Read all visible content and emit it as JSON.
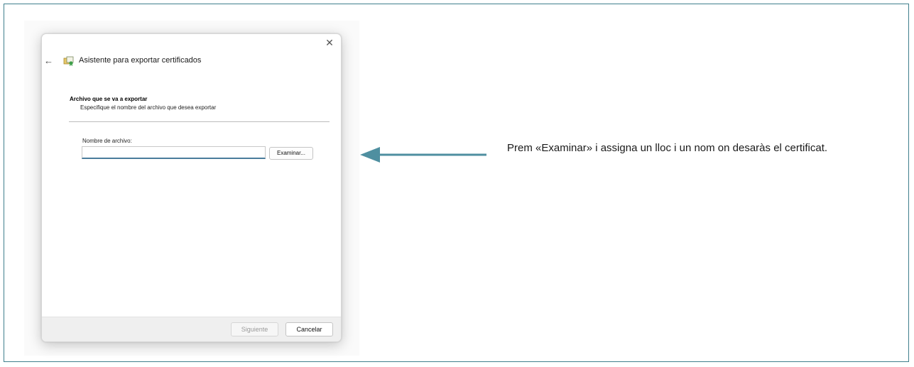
{
  "dialog": {
    "title": "Asistente para exportar certificados",
    "close_glyph": "✕",
    "back_glyph": "←",
    "section_heading": "Archivo que se va a exportar",
    "section_subtitle": "Especifique el nombre del archivo que desea exportar",
    "filename_label": "Nombre de archivo:",
    "filename_value": "",
    "browse_label": "Examinar...",
    "next_label": "Siguiente",
    "cancel_label": "Cancelar"
  },
  "annotation": {
    "text": "Prem «Examinar» i assigna un lloc i un nom on desaràs el certificat.",
    "arrow_color": "#4f8fa0"
  },
  "colors": {
    "frame_border": "#3f7f8c",
    "input_accent": "#4a7c9c"
  }
}
